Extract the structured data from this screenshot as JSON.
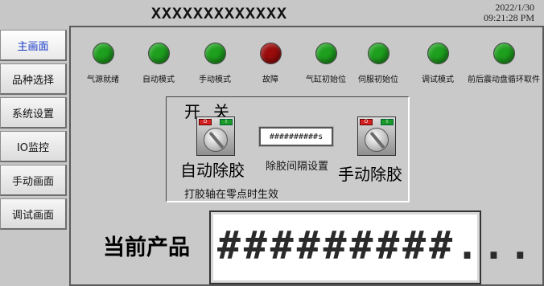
{
  "header": {
    "title": "XXXXXXXXXXXXX",
    "date": "2022/1/30",
    "time": "09:21:28 PM"
  },
  "nav": {
    "items": [
      {
        "label": "主画面",
        "active": true
      },
      {
        "label": "品种选择"
      },
      {
        "label": "系统设置"
      },
      {
        "label": "IO监控"
      },
      {
        "label": "手动画面"
      },
      {
        "label": "调试画面"
      }
    ]
  },
  "status_lamps": [
    {
      "label": "气源就绪",
      "color": "#1ea01e"
    },
    {
      "label": "自动模式",
      "color": "#1ea01e"
    },
    {
      "label": "手动模式",
      "color": "#1ea01e"
    },
    {
      "label": "故障",
      "color": "#9b0c0c"
    },
    {
      "label": "气缸初始位",
      "color": "#1ea01e"
    },
    {
      "label": "伺服初始位",
      "color": "#1ea01e"
    },
    {
      "label": "调试模式",
      "color": "#1ea01e"
    },
    {
      "label": "前后震动盘循环取件",
      "color": "#1ea01e"
    }
  ],
  "glue_panel": {
    "title_left": "开",
    "title_right": "关",
    "auto_label": "自动除胶",
    "manual_label": "手动除胶",
    "interval_label": "除胶间隔设置",
    "interval_value": "##########s",
    "note": "打胶轴在零点时生效",
    "switch_off_text": "O",
    "switch_on_text": "I"
  },
  "product": {
    "label": "当前产品",
    "value": "#########..."
  }
}
